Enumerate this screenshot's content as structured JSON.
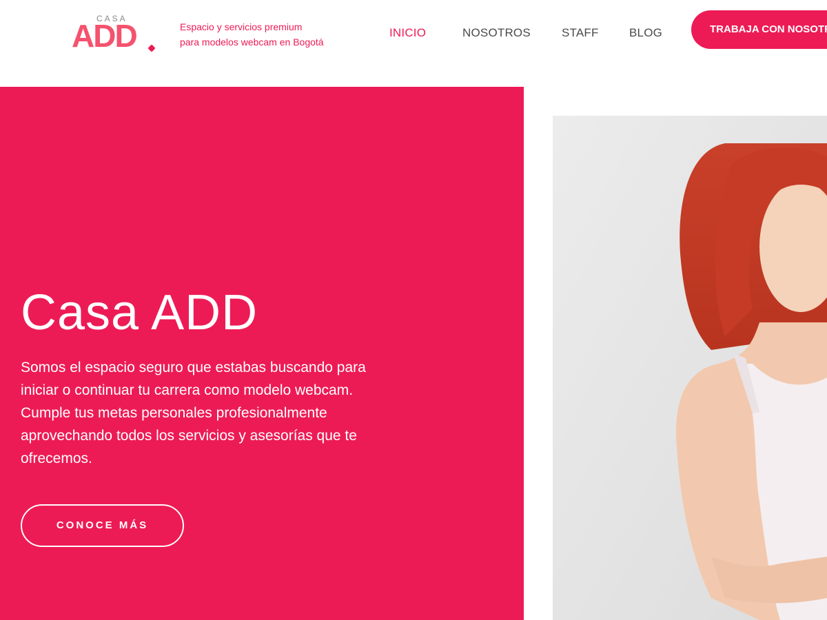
{
  "header": {
    "logo": {
      "small_text": "CASA",
      "main_text": "ADD"
    },
    "tagline": [
      "Espacio y servicios premium",
      "para modelos webcam en Bogotá"
    ],
    "nav": [
      {
        "label": "INICIO",
        "active": true
      },
      {
        "label": "NOSOTROS",
        "active": false
      },
      {
        "label": "STAFF",
        "active": false
      },
      {
        "label": "BLOG",
        "active": false
      }
    ],
    "cta_label": "TRABAJA CON NOSOTRAS"
  },
  "hero": {
    "title": "Casa ADD",
    "text": "Somos el espacio seguro que estabas buscando para iniciar o continuar tu carrera como modelo webcam. Cumple tus metas personales profesionalmente aprovechando todos los servicios y asesorías que te ofrecemos.",
    "button_label": "CONOCE MÁS"
  },
  "colors": {
    "brand": "#ed1b55",
    "nav_text": "#4a4a4a",
    "white": "#ffffff"
  }
}
